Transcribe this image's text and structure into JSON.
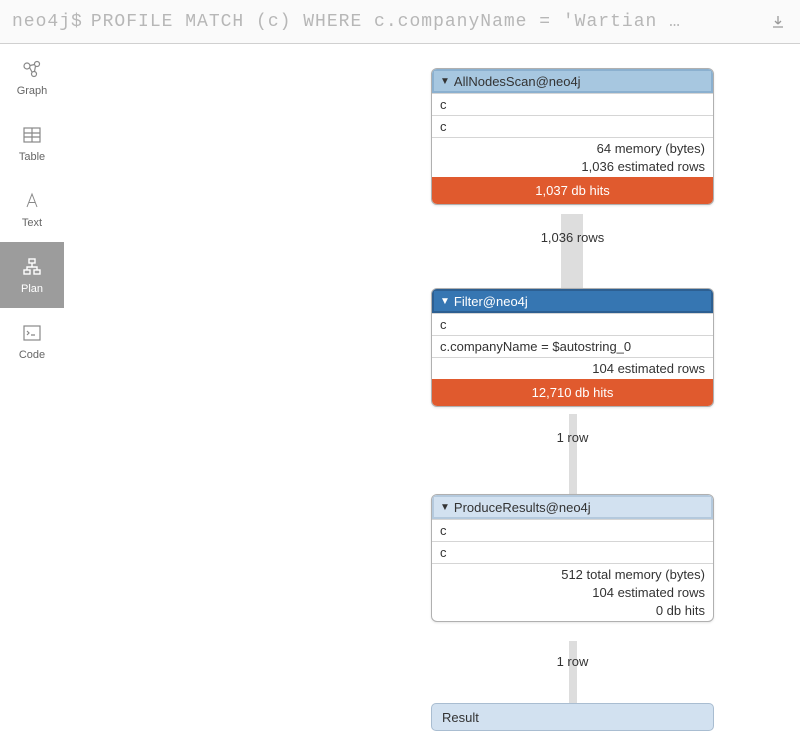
{
  "query": {
    "prompt": "neo4j$",
    "text": "PROFILE MATCH (c) WHERE c.companyName = 'Wartian …"
  },
  "sidebar": {
    "items": [
      {
        "label": "Graph"
      },
      {
        "label": "Table"
      },
      {
        "label": "Text"
      },
      {
        "label": "Plan"
      },
      {
        "label": "Code"
      }
    ]
  },
  "plan": {
    "nodes": [
      {
        "title": "AllNodesScan@neo4j",
        "rows": [
          "c",
          "c"
        ],
        "stats": [
          "64 memory (bytes)",
          "1,036 estimated rows"
        ],
        "bar": "1,037 db hits",
        "flow": "1,036 rows"
      },
      {
        "title": "Filter@neo4j",
        "rows": [
          "c",
          "c.companyName = $autostring_0"
        ],
        "stats": [
          "104 estimated rows"
        ],
        "bar": "12,710 db hits",
        "flow": "1 row"
      },
      {
        "title": "ProduceResults@neo4j",
        "rows": [
          "c",
          "c"
        ],
        "stats": [
          "512 total memory (bytes)",
          "104 estimated rows",
          "0 db hits"
        ],
        "bar": "",
        "flow": "1 row"
      }
    ],
    "result": "Result"
  }
}
